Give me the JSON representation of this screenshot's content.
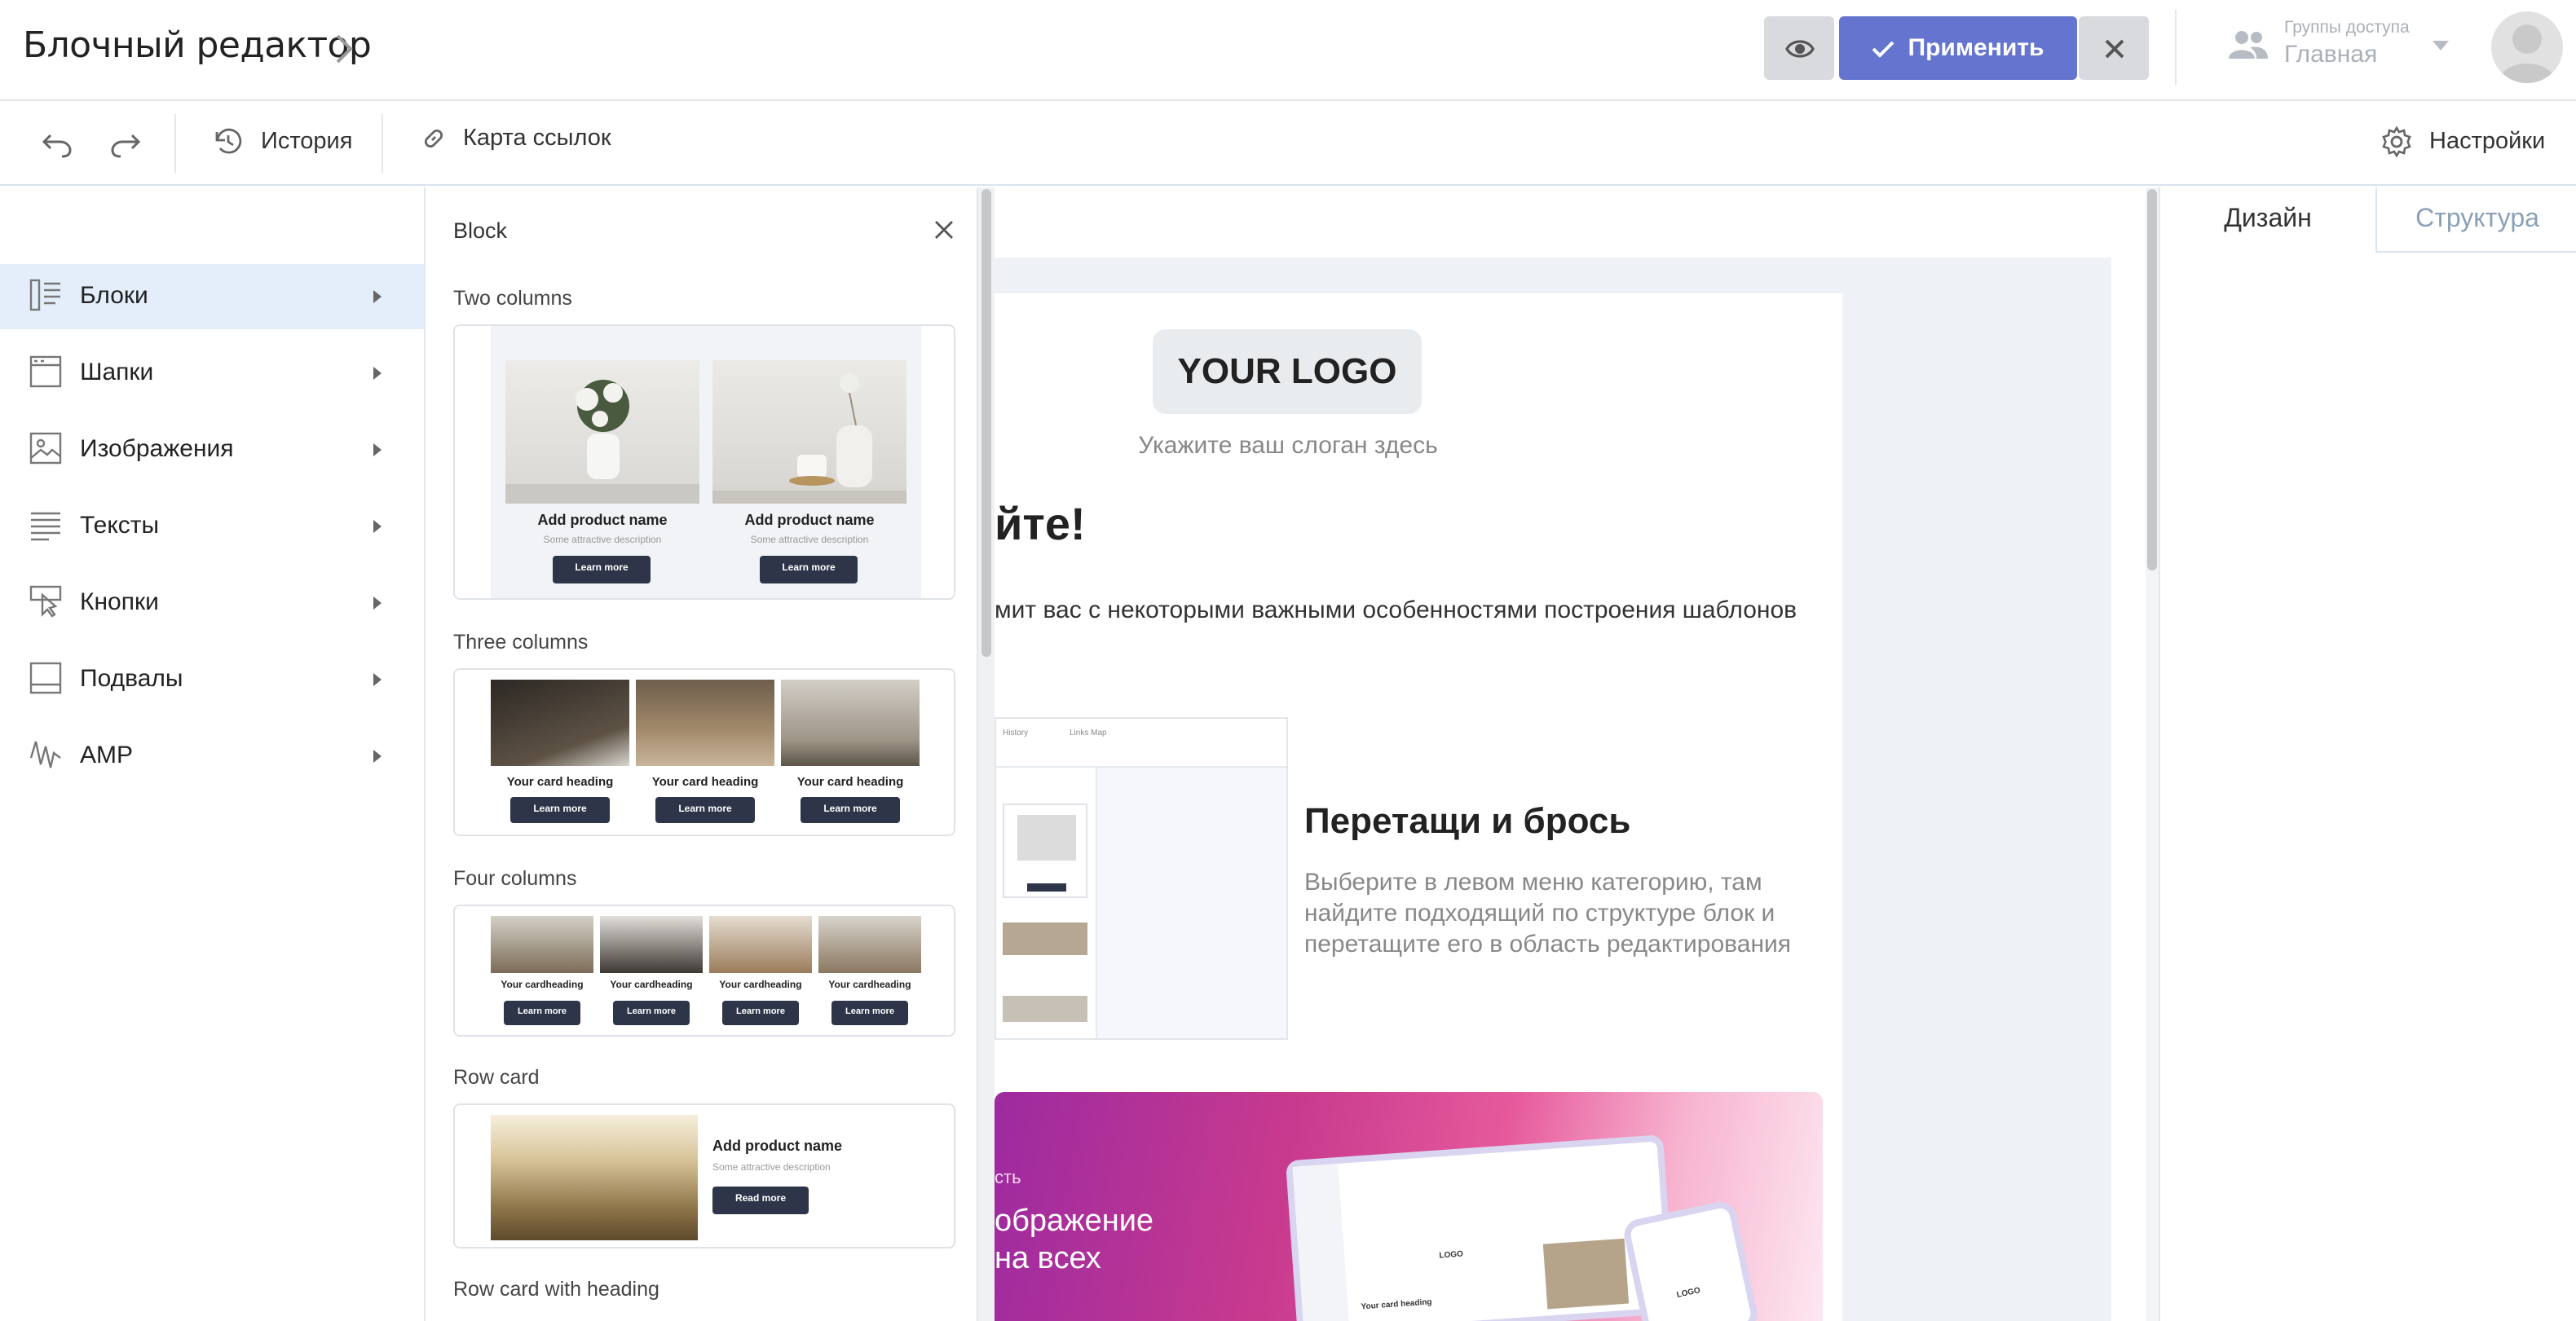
{
  "header": {
    "title": "Блочный редактор",
    "apply_label": "Применить",
    "access_label": "Группы доступа",
    "access_value": "Главная"
  },
  "toolbar": {
    "history_label": "История",
    "link_map_label": "Карта ссылок",
    "settings_label": "Настройки"
  },
  "left_menu": {
    "items": [
      {
        "label": "Блоки",
        "icon": "blocks-icon",
        "active": true
      },
      {
        "label": "Шапки",
        "icon": "header-icon"
      },
      {
        "label": "Изображения",
        "icon": "image-icon"
      },
      {
        "label": "Тексты",
        "icon": "text-icon"
      },
      {
        "label": "Кнопки",
        "icon": "button-icon"
      },
      {
        "label": "Подвалы",
        "icon": "footer-icon"
      },
      {
        "label": "AMP",
        "icon": "amp-icon"
      }
    ]
  },
  "block_panel": {
    "title": "Block",
    "sections": {
      "two_columns": {
        "label": "Two columns",
        "product_name": "Add product name",
        "description": "Some attractive description",
        "button": "Learn more"
      },
      "three_columns": {
        "label": "Three columns",
        "heading": "Your card heading",
        "button": "Learn more"
      },
      "four_columns": {
        "label": "Four columns",
        "heading": "Your cardheading",
        "button": "Learn more"
      },
      "row_card": {
        "label": "Row card",
        "product_name": "Add product name",
        "description": "Some attractive description",
        "button": "Read more"
      },
      "row_card_heading": {
        "label": "Row card with heading"
      }
    }
  },
  "canvas": {
    "logo_text": "YOUR LOGO",
    "slogan": "Укажите ваш слоган здесь",
    "greeting_visible": "йте!",
    "intro_visible": "мит вас с некоторыми важными особенностями построения шаблонов",
    "drag_title": "Перетащи и брось",
    "drag_desc": "Выберите в левом меню категорию, там найдите подходящий по структуре блок и перетащите его в область редактирования",
    "preview_history": "History",
    "preview_links": "Links Map",
    "banner_small": "сть",
    "banner_line1": "ображение",
    "banner_line2": "на всех",
    "mock_logo": "LOGO",
    "mock_heading": "Your card heading"
  },
  "right_panel": {
    "tab_design": "Дизайн",
    "tab_structure": "Структура"
  },
  "colors": {
    "accent": "#6474cf",
    "active_menu_bg": "#e3eefa",
    "button_dark": "#2f3549"
  }
}
